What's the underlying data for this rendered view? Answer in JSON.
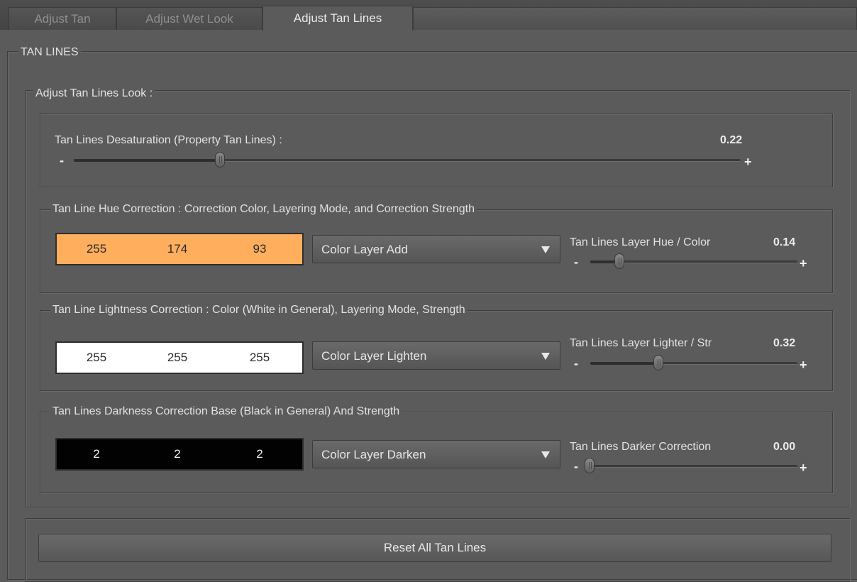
{
  "tabs": [
    {
      "label": "Adjust Tan",
      "active": false
    },
    {
      "label": "Adjust Wet Look",
      "active": false
    },
    {
      "label": "Adjust Tan Lines",
      "active": true
    }
  ],
  "section_title": "TAN LINES",
  "look_group_title": "Adjust Tan Lines Look :",
  "desaturation": {
    "label": "Tan Lines Desaturation (Property Tan Lines) :",
    "value": "0.22",
    "minus": "-",
    "plus": "+"
  },
  "hue_group": {
    "title": "Tan Line Hue Correction : Correction Color, Layering Mode, and Correction Strength",
    "color": {
      "r": "255",
      "g": "174",
      "b": "93",
      "hex": "#ffae5d"
    },
    "mode": "Color Layer Add",
    "slider_label": "Tan Lines Layer Hue / Color",
    "value": "0.14",
    "minus": "-",
    "plus": "+"
  },
  "lightness_group": {
    "title": "Tan Line Lightness Correction : Color (White in General), Layering Mode, Strength",
    "color": {
      "r": "255",
      "g": "255",
      "b": "255",
      "hex": "#ffffff"
    },
    "mode": "Color Layer Lighten",
    "slider_label": "Tan Lines Layer Lighter / Str",
    "value": "0.32",
    "minus": "-",
    "plus": "+"
  },
  "darkness_group": {
    "title": "Tan Lines Darkness Correction Base (Black in General) And Strength",
    "color": {
      "r": "2",
      "g": "2",
      "b": "2",
      "hex": "#020202"
    },
    "mode": "Color Layer Darken",
    "slider_label": "Tan Lines Darker Correction",
    "value": "0.00",
    "minus": "-",
    "plus": "+"
  },
  "reset_label": "Reset All Tan Lines",
  "colors": {
    "background": "#5b5b5b",
    "border": "#3d3d3d",
    "text": "#e2e2e2"
  }
}
